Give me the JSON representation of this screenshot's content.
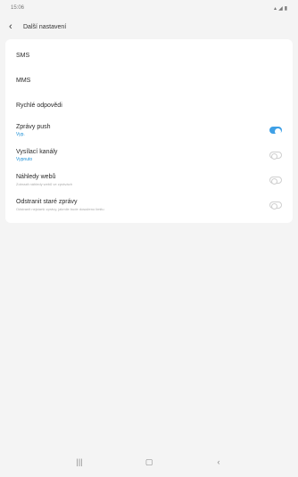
{
  "status_bar": {
    "time": "15:06",
    "icons": "⋰◢▮"
  },
  "app_bar": {
    "title": "Další nastavení"
  },
  "settings": [
    {
      "title": "SMS",
      "subtitle": "",
      "description": "",
      "toggle": null
    },
    {
      "title": "MMS",
      "subtitle": "",
      "description": "",
      "toggle": null
    },
    {
      "title": "Rychlé odpovědi",
      "subtitle": "",
      "description": "",
      "toggle": null
    },
    {
      "title": "Zprávy push",
      "subtitle": "Vyp.",
      "description": "",
      "toggle": "on"
    },
    {
      "title": "Vysílací kanály",
      "subtitle": "Vypnuto",
      "description": "",
      "toggle": "off"
    },
    {
      "title": "Náhledy webů",
      "subtitle": "",
      "description": "Zobrazit náhledy webů ve zprávách",
      "toggle": "off"
    },
    {
      "title": "Odstranit staré zprávy",
      "subtitle": "",
      "description": "Odstranit nejstarší zprávy, jakmile bude dosaženo limitu",
      "toggle": "off"
    }
  ],
  "nav_bar": {
    "recents_icon": "recents-icon",
    "home_icon": "home-icon",
    "back_icon": "back-icon"
  },
  "colors": {
    "accent": "#3fa0e6",
    "subtitle": "#1a8fd6",
    "background": "#f4f4f4"
  }
}
